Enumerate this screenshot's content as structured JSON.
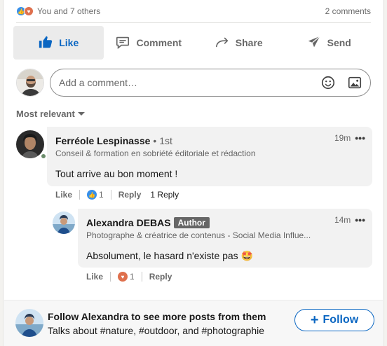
{
  "social": {
    "reactions_text": "You and 7 others",
    "comments_count": "2 comments",
    "reaction_icons": [
      "like-icon",
      "love-icon"
    ]
  },
  "actions": [
    {
      "label": "Like",
      "icon": "thumbs-up-icon",
      "active": true
    },
    {
      "label": "Comment",
      "icon": "comment-icon"
    },
    {
      "label": "Share",
      "icon": "share-arrow-icon"
    },
    {
      "label": "Send",
      "icon": "send-icon"
    }
  ],
  "comment_input": {
    "placeholder": "Add a comment…",
    "value": ""
  },
  "sort": {
    "label": "Most relevant"
  },
  "comments": [
    {
      "name": "Ferréole Lespinasse",
      "degree": "• 1st",
      "headline": "Conseil & formation en sobriété éditoriale et rédaction",
      "text": "Tout arrive au bon moment !",
      "time": "19m",
      "like_label": "Like",
      "reaction_count": "1",
      "reply_label": "Reply",
      "reply_count": "1 Reply"
    },
    {
      "name": "Alexandra DEBAS",
      "badge": "Author",
      "headline": "Photographe & créatrice de contenus - Social Media Influe...",
      "text": "Absolument, le hasard n'existe pas 🤩",
      "time": "14m",
      "like_label": "Like",
      "reaction_count": "1",
      "reply_label": "Reply"
    }
  ],
  "follow": {
    "title": "Follow Alexandra to see more posts from them",
    "subtitle": "Talks about #nature, #outdoor, and #photographie",
    "button": "Follow"
  },
  "colors": {
    "accent": "#0a66c2",
    "like": "#378fe9",
    "love": "#df704d",
    "author_badge": "#666666"
  }
}
